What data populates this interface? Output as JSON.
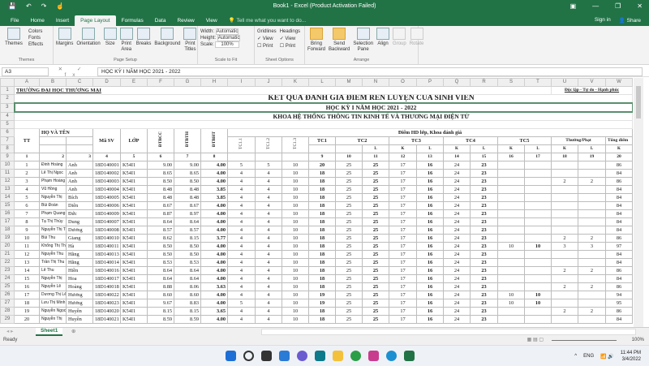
{
  "window": {
    "title": "Book1 - Excel (Product Activation Failed)",
    "sign_in": "Sign in",
    "share": "Share"
  },
  "tabs": [
    {
      "label": "File"
    },
    {
      "label": "Home"
    },
    {
      "label": "Insert"
    },
    {
      "label": "Page Layout",
      "active": true
    },
    {
      "label": "Formulas"
    },
    {
      "label": "Data"
    },
    {
      "label": "Review"
    },
    {
      "label": "View"
    }
  ],
  "tell_me": "Tell me what you want to do...",
  "ribbon": {
    "themes": {
      "label": "Themes",
      "themes": "Themes",
      "colors": "Colors",
      "fonts": "Fonts",
      "effects": "Effects"
    },
    "page_setup": {
      "label": "Page Setup",
      "margins": "Margins",
      "orientation": "Orientation",
      "size": "Size",
      "print_area": "Print Area",
      "breaks": "Breaks",
      "background": "Background",
      "print_titles": "Print Titles"
    },
    "scale": {
      "label": "Scale to Fit",
      "width": "Width:",
      "width_val": "Automatic",
      "height": "Height:",
      "height_val": "Automatic",
      "scale": "Scale:",
      "scale_val": "100%"
    },
    "sheet_options": {
      "label": "Sheet Options",
      "gridlines": "Gridlines",
      "headings": "Headings",
      "view": "View",
      "print": "Print"
    },
    "arrange": {
      "label": "Arrange",
      "bring_forward": "Bring Forward",
      "send_backward": "Send Backward",
      "selection_pane": "Selection Pane",
      "align": "Align",
      "group": "Group",
      "rotate": "Rotate"
    }
  },
  "formula_bar": {
    "name_box": "A3",
    "fx": "✕ ✓ fx",
    "value": "HỌC KỲ I NĂM HỌC 2021 - 2022"
  },
  "columns": [
    "A",
    "B",
    "C",
    "D",
    "E",
    "F",
    "G",
    "H",
    "I",
    "J",
    "K",
    "L",
    "M",
    "N",
    "O",
    "P",
    "Q",
    "R",
    "S",
    "T",
    "U",
    "V",
    "W"
  ],
  "sheet": {
    "school": "TRƯỜNG ĐẠI HỌC THƯƠNG MẠI",
    "motto": "Độc lập - Tự do - Hạnh phúc",
    "title": "KẾT QUẢ ĐÁNH GIÁ ĐIỂM RÈN LUYỆN CỦA SINH VIÊN",
    "semester": "HỌC KỲ I NĂM HỌC 2021 - 2022",
    "faculty": "KHOA HỆ THỐNG THÔNG TIN KINH TẾ VÀ THƯƠNG MẠI ĐIỆN TỬ",
    "h": {
      "tt": "TT",
      "name": "HỌ VÀ TÊN",
      "masv": "Mã SV",
      "lop": "LỚP",
      "dtbcc": "ĐTBCC",
      "dtbth": "ĐTBTH",
      "dtbht": "ĐTBHT",
      "tc11": "TC1.1",
      "tc12": "TC1.2",
      "tc13": "TC1.3",
      "eval": "Điểm HD lớp, Khoa đánh giá",
      "tc1": "TC1",
      "tc2": "TC2",
      "tc3": "TC3",
      "tc4": "TC4",
      "tc5": "TC5",
      "thuong": "Thưởng/Phạt",
      "tong": "Tổng điểm",
      "L": "L",
      "K": "K"
    },
    "index_row": [
      "1",
      "2",
      "3",
      "4",
      "5",
      "6",
      "7",
      "8",
      "",
      "",
      "",
      "9",
      "10",
      "11",
      "12",
      "13",
      "14",
      "15",
      "16",
      "17",
      "18",
      "19",
      "20"
    ],
    "rows": [
      [
        "1",
        "Đinh Hoàng",
        "Anh",
        "18D140001",
        "K54I1",
        "9.00",
        "9.00",
        "4.00",
        "5",
        "5",
        "10",
        "20",
        "25",
        "25",
        "17",
        "16",
        "24",
        "23",
        "",
        "",
        "",
        "",
        "86"
      ],
      [
        "2",
        "Lê Thị Ngọc",
        "Anh",
        "18D140002",
        "K54I1",
        "8.65",
        "8.65",
        "4.00",
        "4",
        "4",
        "10",
        "18",
        "25",
        "25",
        "17",
        "16",
        "24",
        "23",
        "",
        "",
        "",
        "",
        "84"
      ],
      [
        "3",
        "Phạm Hoàng",
        "Anh",
        "18D140003",
        "K54I1",
        "8.50",
        "8.50",
        "4.00",
        "4",
        "4",
        "10",
        "18",
        "25",
        "25",
        "17",
        "16",
        "24",
        "23",
        "",
        "",
        "2",
        "2",
        "86"
      ],
      [
        "4",
        "Vũ Hồng",
        "Anh",
        "18D140004",
        "K54I1",
        "8.48",
        "8.48",
        "3.85",
        "4",
        "4",
        "10",
        "18",
        "25",
        "25",
        "17",
        "16",
        "24",
        "23",
        "",
        "",
        "",
        "",
        "84"
      ],
      [
        "5",
        "Nguyễn Thị",
        "Bích",
        "18D140005",
        "K54I1",
        "8.48",
        "8.48",
        "3.85",
        "4",
        "4",
        "10",
        "18",
        "25",
        "25",
        "17",
        "16",
        "24",
        "23",
        "",
        "",
        "",
        "",
        "84"
      ],
      [
        "6",
        "Bùi Đoàn",
        "Diên",
        "18D140006",
        "K54I1",
        "8.67",
        "8.67",
        "4.00",
        "4",
        "4",
        "10",
        "18",
        "25",
        "25",
        "17",
        "16",
        "24",
        "23",
        "",
        "",
        "",
        "",
        "84"
      ],
      [
        "7",
        "Phạm Quang",
        "Đức",
        "18D140009",
        "K54I1",
        "8.87",
        "8.97",
        "4.00",
        "4",
        "4",
        "10",
        "18",
        "25",
        "25",
        "17",
        "16",
        "24",
        "23",
        "",
        "",
        "",
        "",
        "84"
      ],
      [
        "8",
        "Tạ Thị Thùy",
        "Dung",
        "18D140007",
        "K54I1",
        "8.64",
        "8.64",
        "4.00",
        "4",
        "4",
        "10",
        "18",
        "25",
        "25",
        "17",
        "16",
        "24",
        "23",
        "",
        "",
        "",
        "",
        "84"
      ],
      [
        "9",
        "Nguyễn Thị Thùy",
        "Dương",
        "18D140008",
        "K54I1",
        "8.57",
        "8.57",
        "4.00",
        "4",
        "4",
        "10",
        "18",
        "25",
        "25",
        "17",
        "16",
        "24",
        "23",
        "",
        "",
        "",
        "",
        "84"
      ],
      [
        "10",
        "Bùi Thu",
        "Giang",
        "18D140010",
        "K54I1",
        "8.62",
        "8.15",
        "3.77",
        "4",
        "4",
        "10",
        "18",
        "25",
        "25",
        "17",
        "16",
        "24",
        "23",
        "",
        "",
        "2",
        "2",
        "86"
      ],
      [
        "11",
        "Khổng Thị Thu",
        "Hà",
        "18D140011",
        "K54I1",
        "8.50",
        "8.50",
        "4.00",
        "4",
        "4",
        "10",
        "18",
        "25",
        "25",
        "17",
        "16",
        "24",
        "23",
        "10",
        "10",
        "3",
        "3",
        "97"
      ],
      [
        "12",
        "Nguyễn Thu",
        "Hằng",
        "18D140013",
        "K54I1",
        "8.50",
        "8.50",
        "4.00",
        "4",
        "4",
        "10",
        "18",
        "25",
        "25",
        "17",
        "16",
        "24",
        "23",
        "",
        "",
        "",
        "",
        "84"
      ],
      [
        "13",
        "Trần Thị Thu",
        "Hằng",
        "18D140014",
        "K54I1",
        "8.53",
        "8.53",
        "4.00",
        "4",
        "4",
        "10",
        "18",
        "25",
        "25",
        "17",
        "16",
        "24",
        "23",
        "",
        "",
        "",
        "",
        "84"
      ],
      [
        "14",
        "Lê Thu",
        "Hiền",
        "18D140016",
        "K54I1",
        "8.64",
        "8.64",
        "4.00",
        "4",
        "4",
        "10",
        "18",
        "25",
        "25",
        "17",
        "16",
        "24",
        "23",
        "",
        "",
        "2",
        "2",
        "86"
      ],
      [
        "15",
        "Nguyễn Thị",
        "Hoa",
        "18D140017",
        "K54I1",
        "8.64",
        "8.64",
        "4.00",
        "4",
        "4",
        "10",
        "18",
        "25",
        "25",
        "17",
        "16",
        "24",
        "23",
        "",
        "",
        "",
        "",
        "84"
      ],
      [
        "16",
        "Nguyễn Lê",
        "Hoàng",
        "18D140018",
        "K54I1",
        "8.88",
        "8.06",
        "3.63",
        "4",
        "4",
        "10",
        "18",
        "25",
        "25",
        "17",
        "16",
        "24",
        "23",
        "",
        "",
        "2",
        "2",
        "86"
      ],
      [
        "17",
        "Dương Thị Lê",
        "Hương",
        "18D140022",
        "K54I1",
        "8.60",
        "8.60",
        "4.00",
        "4",
        "4",
        "10",
        "19",
        "25",
        "25",
        "17",
        "16",
        "24",
        "23",
        "10",
        "10",
        "",
        "",
        "94"
      ],
      [
        "18",
        "Lưu Thị Minh",
        "Hương",
        "18D140023",
        "K54I1",
        "9.67",
        "8.83",
        "4.00",
        "5",
        "4",
        "10",
        "19",
        "25",
        "25",
        "17",
        "16",
        "24",
        "23",
        "10",
        "10",
        "",
        "",
        "95"
      ],
      [
        "19",
        "Nguyễn Ngọc",
        "Huyền",
        "18D140020",
        "K54I1",
        "8.15",
        "8.15",
        "3.65",
        "4",
        "4",
        "10",
        "18",
        "25",
        "25",
        "17",
        "16",
        "24",
        "23",
        "",
        "",
        "2",
        "2",
        "86"
      ],
      [
        "20",
        "Nguyễn Thị",
        "Huyền",
        "18D140021",
        "K54I1",
        "8.59",
        "8.59",
        "4.00",
        "4",
        "4",
        "10",
        "18",
        "25",
        "25",
        "17",
        "16",
        "24",
        "23",
        "",
        "",
        "",
        "",
        "84"
      ]
    ]
  },
  "sheet_tab": "Sheet1",
  "status": {
    "ready": "Ready",
    "zoom": "100%"
  },
  "taskbar": {
    "lang": "ENG",
    "time": "11:44 PM",
    "date": "3/4/2022"
  },
  "accent": "#217346"
}
